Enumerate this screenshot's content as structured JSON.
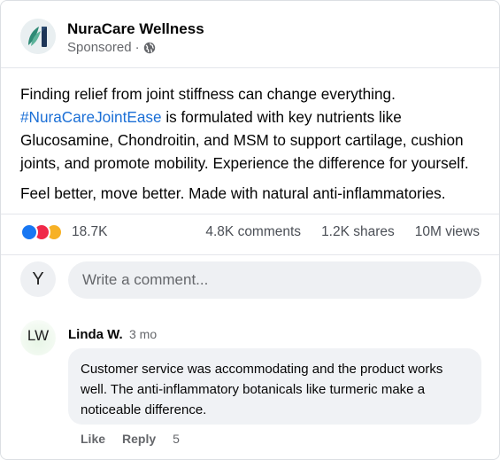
{
  "post": {
    "page_name": "NuraCare Wellness",
    "sponsored_label": "Sponsored",
    "separator": "·",
    "body": {
      "line1_pre": "Finding relief from joint stiffness can change everything. ",
      "hashtag": "#NuraCareJointEase",
      "line1_post": " is formulated with key nutrients like Glucosamine, Chondroitin, and MSM to support cartilage, cushion joints, and promote mobility. Experience the difference for yourself.",
      "paragraph2": "Feel better, move better. Made with natural anti-inflammatories."
    },
    "stats": {
      "reactions": "18.7K",
      "comments": "4.8K comments",
      "shares": "1.2K shares",
      "views": "10M views"
    },
    "colors": {
      "hashtag": "#1b6fd6",
      "reaction_like": "#1877f2",
      "reaction_love": "#f02849",
      "reaction_care": "#f7b125"
    }
  },
  "composer": {
    "avatar_initial": "Y",
    "placeholder": "Write a comment..."
  },
  "comment": {
    "avatar_initials": "LW",
    "author": "Linda W.",
    "time": "3 mo",
    "text": "Customer service was accommodating and the product works well. The anti-inflammatory botanicals like turmeric make a noticeable difference.",
    "like_label": "Like",
    "reply_label": "Reply",
    "like_count": "5"
  }
}
